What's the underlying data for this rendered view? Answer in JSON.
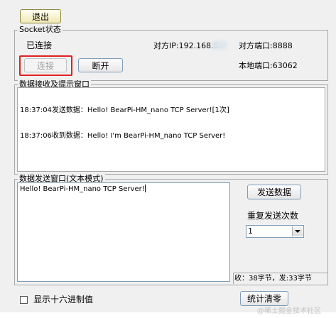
{
  "toolbar": {
    "exit_label": "退出"
  },
  "socket": {
    "legend": "Socket状态",
    "status": "已连接",
    "remote_ip_label": "对方IP:192.168.0.",
    "remote_port": "对方端口:8888",
    "connect_label": "连接",
    "disconnect_label": "断开",
    "local_port": "本地端口:63062"
  },
  "receive": {
    "legend": "数据接收及提示窗口",
    "lines": [
      "18:37:04发送数据：Hello! BearPi-HM_nano TCP Server![1次]",
      "18:37:06收到数据：Hello! I'm BearPi-HM_nano TCP Server!"
    ]
  },
  "send": {
    "legend": "数据发送窗口(文本模式)",
    "text": "Hello! BearPi-HM_nano TCP Server!",
    "send_button": "发送数据",
    "repeat_label": "重复发送次数",
    "repeat_value": "1",
    "stats": "收：38字节，发:33字节"
  },
  "bottom": {
    "hex_label": "显示十六进制值",
    "clear_stats": "统计清零"
  },
  "watermark": "@稀土掘金技术社区"
}
